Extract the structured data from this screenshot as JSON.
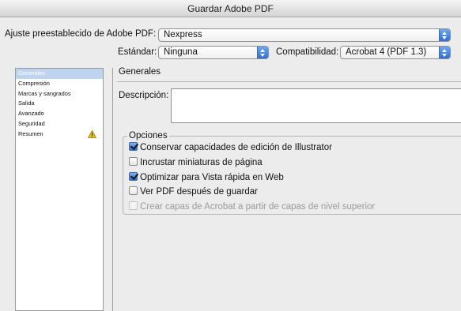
{
  "window": {
    "title": "Guardar Adobe PDF"
  },
  "preset": {
    "label": "Ajuste preestablecido de Adobe PDF:",
    "value": "Nexpress"
  },
  "standard": {
    "label": "Estándar:",
    "value": "Ninguna"
  },
  "compatibility": {
    "label": "Compatibilidad:",
    "value": "Acrobat 4 (PDF 1.3)"
  },
  "sidebar": {
    "items": [
      {
        "label": "Generales",
        "selected": true
      },
      {
        "label": "Compresión"
      },
      {
        "label": "Marcas y sangrados"
      },
      {
        "label": "Salida"
      },
      {
        "label": "Avanzado"
      },
      {
        "label": "Seguridad"
      },
      {
        "label": "Resumen",
        "icon": "warning-icon"
      }
    ]
  },
  "general": {
    "title": "Generales",
    "description_label": "Descripción:",
    "description_value": ""
  },
  "options": {
    "legend": "Opciones",
    "items": [
      {
        "label": "Conservar capacidades de edición de Illustrator",
        "checked": true,
        "enabled": true
      },
      {
        "label": "Incrustar miniaturas de página",
        "checked": false,
        "enabled": true
      },
      {
        "label": "Optimizar para Vista rápida en Web",
        "checked": true,
        "enabled": true
      },
      {
        "label": "Ver PDF después de guardar",
        "checked": false,
        "enabled": true
      },
      {
        "label": "Crear capas de Acrobat a partir de capas de nivel superior",
        "checked": false,
        "enabled": false
      }
    ]
  },
  "colors": {
    "accent": "#2d6fd6",
    "selection": "#bdd3ee",
    "warning": "#f2c200"
  }
}
